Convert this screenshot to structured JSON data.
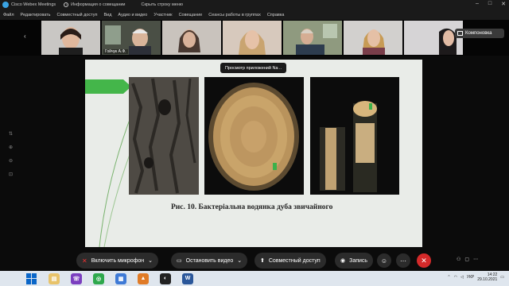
{
  "titlebar": {
    "app_title": "Cisco Webex Meetings",
    "meeting_info": "Информация о совещании",
    "hide_menu": "Скрыть строку меню",
    "controls": [
      "–",
      "□",
      "✕"
    ]
  },
  "menu": [
    "Файл",
    "Редактировать",
    "Совместный доступ",
    "Вид",
    "Аудио и видео",
    "Участник",
    "Совещание",
    "Сеансы работы в группах",
    "Справка"
  ],
  "thumbnails": [
    {
      "name": "",
      "bg": "#c9c7c4"
    },
    {
      "name": "Гойчук А.Ф.",
      "bg": "#4a4f45"
    },
    {
      "name": "",
      "bg": "#c9c3bd"
    },
    {
      "name": "",
      "bg": "#d7c9bd"
    },
    {
      "name": "",
      "bg": "#8f9a7f"
    },
    {
      "name": "",
      "bg": "#d2d0ce"
    },
    {
      "name": "",
      "bg": "#d6d4d6"
    }
  ],
  "layout_button": "Компоновка",
  "viewer_tip": "Просмотр приложений Na ..",
  "slide": {
    "caption": "Рис. 10. Бактеріальна водянка дуба звичайного",
    "accent_color": "#44b64a"
  },
  "controls": {
    "mute_label": "Включить микрофон",
    "video_label": "Остановить видео",
    "share_label": "Совместный доступ",
    "record_label": "Запись",
    "end_color": "#d42a2a"
  },
  "taskbar": {
    "language": "УКР",
    "time": "14:22",
    "date": "29.10.2021"
  }
}
